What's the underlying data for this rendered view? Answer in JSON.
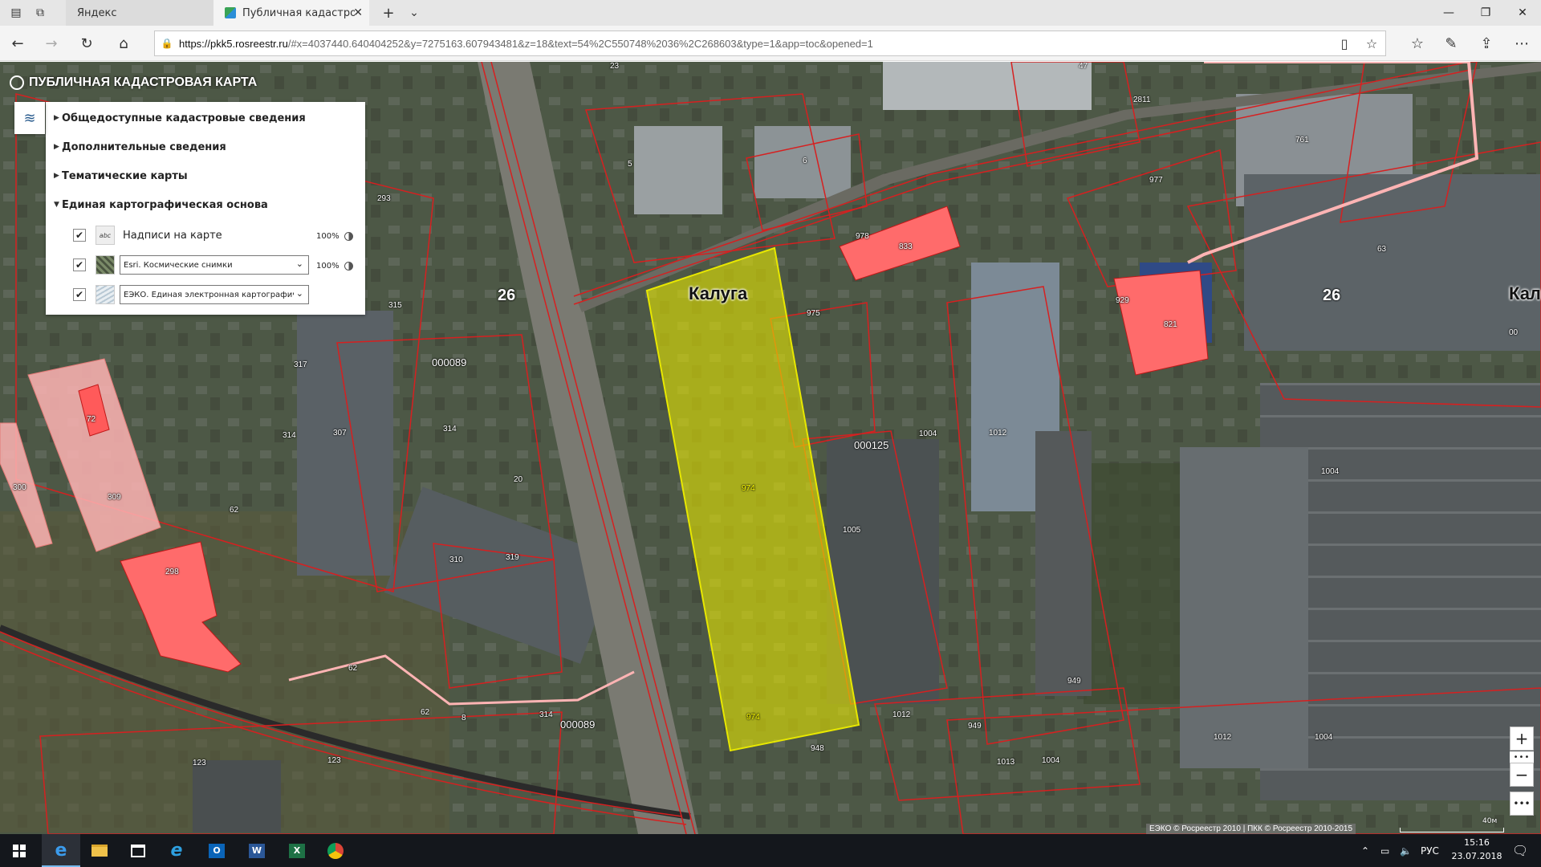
{
  "browser": {
    "tabs": [
      {
        "title": "Яндекс"
      },
      {
        "title": "Публичная кадастрова"
      }
    ],
    "url_host": "https://pkk5.rosreestr.ru",
    "url_rest": "/#x=4037440.640404252&y=7275163.607943481&z=18&text=54%2C550748%2036%2C268603&type=1&app=toc&opened=1"
  },
  "app": {
    "title": "ПУБЛИЧНАЯ КАДАСТРОВАЯ КАРТА"
  },
  "panel": {
    "sections": [
      {
        "label": "Общедоступные кадастровые сведения",
        "expanded": false
      },
      {
        "label": "Дополнительные сведения",
        "expanded": false
      },
      {
        "label": "Тематические карты",
        "expanded": false
      },
      {
        "label": "Единая картографическая основа",
        "expanded": true
      }
    ],
    "layers": [
      {
        "label": "Надписи на карте",
        "checked": true,
        "opacity": "100%",
        "thumb_text": "abc"
      },
      {
        "select": "Esri. Космические снимки",
        "checked": true,
        "opacity": "100%"
      },
      {
        "select": "ЕЭКО. Единая электронная картографиче",
        "checked": true
      }
    ]
  },
  "map": {
    "city_label": "Калуга",
    "city_label_right": "Кал",
    "quarter_labels": [
      "26",
      "26",
      "000089",
      "000125",
      "000089"
    ],
    "parcel_labels": [
      "23",
      "47",
      "2811",
      "761",
      "5",
      "6",
      "293",
      "977",
      "978",
      "833",
      "63",
      "975",
      "929",
      "821",
      "315",
      "317",
      "307",
      "314",
      "314",
      "00",
      "72",
      "309",
      "1004",
      "1012",
      "1004",
      "974",
      "300",
      "62",
      "298",
      "310",
      "319",
      "20",
      "1005",
      "62",
      "62",
      "8",
      "314",
      "123",
      "123",
      "974",
      "948",
      "1012",
      "949",
      "949",
      "1013",
      "1004",
      "1012",
      "1004"
    ],
    "attribution": "ЕЭКО © Росреестр 2010 | ПКК © Росреестр 2010-2015",
    "scale_label": "40м",
    "colors": {
      "highlight": "#e6e600",
      "parcel_fill": "#ff6b6b",
      "border": "#d62020"
    }
  },
  "taskbar": {
    "lang": "РУС",
    "time": "15:16",
    "date": "23.07.2018"
  }
}
